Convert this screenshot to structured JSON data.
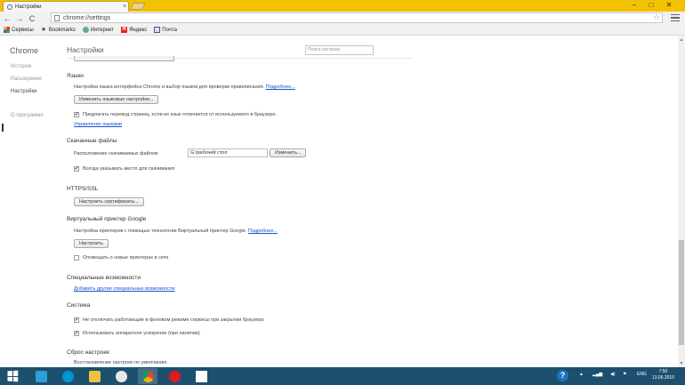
{
  "tab": {
    "title": "Настройки",
    "close": "×"
  },
  "window": {
    "minimize": "–",
    "maximize": "□",
    "close": "✕"
  },
  "toolbar": {
    "back": "←",
    "forward": "→",
    "reload": "C",
    "url": "chrome://settings",
    "star": "☆"
  },
  "bookmarks": [
    {
      "label": "Сервисы",
      "icon": "apps-grid-icon"
    },
    {
      "label": "Bookmarks",
      "icon": "star-icon"
    },
    {
      "label": "Интернет",
      "icon": "globe-icon"
    },
    {
      "label": "Яндекс",
      "icon": "yandex-icon",
      "glyph": "Я"
    },
    {
      "label": "Почта",
      "icon": "mail-icon"
    }
  ],
  "sidebar": {
    "brand": "Chrome",
    "items": [
      {
        "label": "История",
        "active": false
      },
      {
        "label": "Расширения",
        "active": false
      },
      {
        "label": "Настройки",
        "active": true
      },
      {
        "label": "О программе",
        "active": false
      }
    ]
  },
  "main": {
    "title": "Настройки",
    "search_placeholder": "Поиск настроек",
    "languages": {
      "heading": "Языки",
      "description": "Настройка языка интерфейса Chrome и выбор языков для проверки правописания.",
      "more_link": "Подробнее...",
      "button": "Изменить языковые настройки...",
      "offer_translate": "Предлагать перевод страниц, если их язык отличается от используемого в браузере.",
      "offer_translate_checked": true,
      "manage_link": "Управление языками"
    },
    "downloads": {
      "heading": "Скачанные файлы",
      "location_label": "Расположение скачиваемых файлов:",
      "location_value": "G:\\рабочий стол",
      "change_button": "Изменить...",
      "ask_where": "Всегда указывать место для скачивания",
      "ask_where_checked": true
    },
    "https": {
      "heading": "HTTPS/SSL",
      "button": "Настроить сертификаты..."
    },
    "cloud_print": {
      "heading": "Виртуальный принтер Google",
      "description": "Настройка принтеров с помощью технологии Виртуальный принтер Google.",
      "more_link": "Подробнее...",
      "button": "Настроить",
      "notify": "Оповещать о новых принтерах в сети",
      "notify_checked": false
    },
    "accessibility": {
      "heading": "Специальные возможности",
      "link": "Добавить другие специальные возможности"
    },
    "system": {
      "heading": "Система",
      "background": "Не отключать работающие в фоновом режиме сервисы при закрытии браузера",
      "background_checked": true,
      "hardware": "Использовать аппаратное ускорение (при наличии)",
      "hardware_checked": true
    },
    "reset": {
      "heading": "Сброс настроек",
      "description": "Восстановление настроек по умолчанию."
    }
  },
  "taskbar": {
    "apps": [
      {
        "icon": "rocket-icon",
        "color": "#2a9fd8"
      },
      {
        "icon": "hp-icon",
        "color": "#0096d6"
      },
      {
        "icon": "file-explorer-icon",
        "color": "#f0c040"
      },
      {
        "icon": "mail-at-icon",
        "color": "#e8e8e8"
      },
      {
        "icon": "chrome-icon",
        "color": "#4caf50"
      },
      {
        "icon": "opera-icon",
        "color": "#e0191f"
      },
      {
        "icon": "document-icon",
        "color": "#ffffff"
      }
    ],
    "lang": "ENG",
    "time": "7:50",
    "date": "13.06.2015"
  }
}
